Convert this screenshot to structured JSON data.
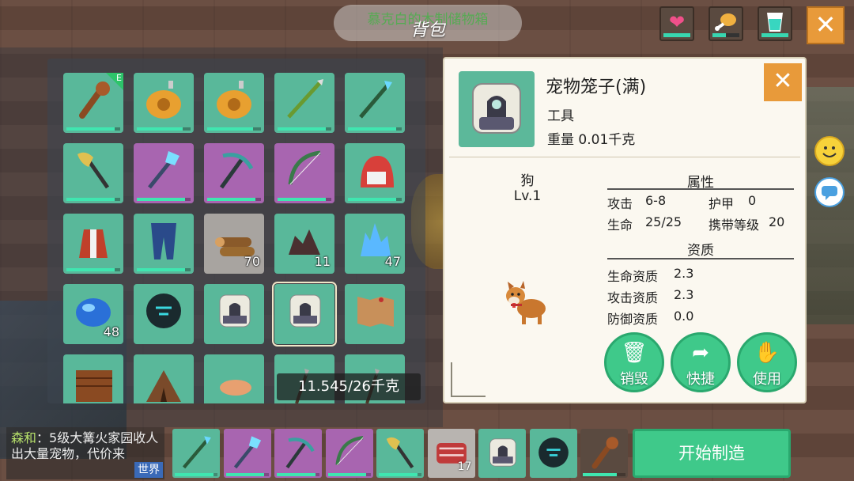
{
  "header": {
    "chest_title": "慕克白的木制储物箱",
    "title": "背包"
  },
  "stats": [
    {
      "name": "health",
      "icon": "heart-icon",
      "glyph": "❤",
      "color": "#f0508a",
      "level": 1.0
    },
    {
      "name": "hunger",
      "icon": "drumstick-icon",
      "glyph": "🍗",
      "color": "#f0b040",
      "level": 0.5
    },
    {
      "name": "thirst",
      "icon": "water-glass-icon",
      "glyph": "🥤",
      "color": "#38d6c0",
      "level": 1.0
    }
  ],
  "inventory": {
    "weight": "11.545/26千克",
    "items": [
      {
        "name": "wooden-club",
        "bg": "green",
        "dur": 0.9,
        "count": "",
        "equipped": true,
        "equip_label": "E"
      },
      {
        "name": "leather-water-bag",
        "bg": "green",
        "dur": 0.85,
        "count": ""
      },
      {
        "name": "leather-water-bag",
        "bg": "green",
        "dur": 0.85,
        "count": ""
      },
      {
        "name": "bamboo-spear",
        "bg": "green",
        "dur": 0.9,
        "count": ""
      },
      {
        "name": "crystal-spear",
        "bg": "green",
        "dur": 0.9,
        "count": ""
      },
      {
        "name": "battle-axe",
        "bg": "green",
        "dur": 0.9,
        "count": ""
      },
      {
        "name": "crystal-staff",
        "bg": "purple",
        "dur": 0.9,
        "count": ""
      },
      {
        "name": "pickaxe",
        "bg": "purple",
        "dur": 0.9,
        "count": ""
      },
      {
        "name": "bow",
        "bg": "purple",
        "dur": 0.9,
        "count": ""
      },
      {
        "name": "red-hood",
        "bg": "green",
        "dur": 0.9,
        "count": ""
      },
      {
        "name": "fur-coat",
        "bg": "green",
        "dur": 0.9,
        "count": ""
      },
      {
        "name": "pants",
        "bg": "green",
        "dur": 0.9,
        "count": ""
      },
      {
        "name": "wood-logs",
        "bg": "grey",
        "dur": 0,
        "count": "70"
      },
      {
        "name": "dark-ore",
        "bg": "green",
        "dur": 0,
        "count": "11"
      },
      {
        "name": "blue-crystals",
        "bg": "green",
        "dur": 0,
        "count": "47"
      },
      {
        "name": "blue-gem",
        "bg": "green",
        "dur": 0,
        "count": "48"
      },
      {
        "name": "dark-orb",
        "bg": "green",
        "dur": 0,
        "count": ""
      },
      {
        "name": "pet-cage",
        "bg": "green",
        "dur": 0,
        "count": ""
      },
      {
        "name": "pet-cage-selected",
        "bg": "green",
        "dur": 0,
        "count": "",
        "selected": true
      },
      {
        "name": "treasure-map",
        "bg": "green",
        "dur": 0,
        "count": ""
      },
      {
        "name": "wooden-crate",
        "bg": "green",
        "dur": 0,
        "count": ""
      },
      {
        "name": "tent",
        "bg": "green",
        "dur": 0,
        "count": ""
      },
      {
        "name": "fish-item",
        "bg": "green",
        "dur": 0,
        "count": ""
      },
      {
        "name": "spear-item",
        "bg": "green",
        "dur": 0,
        "count": ""
      },
      {
        "name": "spear-item-2",
        "bg": "green",
        "dur": 0,
        "count": ""
      }
    ]
  },
  "detail": {
    "name": "宠物笼子(满)",
    "type": "工具",
    "weight": "重量 0.01千克",
    "pet_name": "狗",
    "pet_level": "Lv.1",
    "attr_header": "属性",
    "attack_label": "攻击",
    "attack_value": "6-8",
    "armor_label": "护甲",
    "armor_value": "0",
    "hp_label": "生命",
    "hp_value": "25/25",
    "carry_label": "携带等级",
    "carry_value": "20",
    "aptitude_header": "资质",
    "hp_apt_label": "生命资质",
    "hp_apt_value": "2.3",
    "atk_apt_label": "攻击资质",
    "atk_apt_value": "2.3",
    "def_apt_label": "防御资质",
    "def_apt_value": "0.0",
    "buttons": {
      "destroy": "销毁",
      "shortcut": "快捷",
      "use": "使用"
    }
  },
  "chat": {
    "sender": "森和",
    "message": "：5级大篝火家园收人　出大量宠物，代价来",
    "channel": "世界"
  },
  "hotbar": {
    "items": [
      {
        "name": "crystal-spear",
        "bg": "green",
        "dur": 0.9,
        "count": ""
      },
      {
        "name": "crystal-staff",
        "bg": "purple",
        "dur": 0.9,
        "count": ""
      },
      {
        "name": "pickaxe",
        "bg": "purple",
        "dur": 0.9,
        "count": ""
      },
      {
        "name": "bow",
        "bg": "purple",
        "dur": 0.9,
        "count": ""
      },
      {
        "name": "battle-axe",
        "bg": "green",
        "dur": 0.9,
        "count": ""
      },
      {
        "name": "raw-meat",
        "bg": "grey",
        "dur": 0,
        "count": "17"
      },
      {
        "name": "pet-cage",
        "bg": "green",
        "dur": 0,
        "count": ""
      },
      {
        "name": "dark-orb",
        "bg": "green",
        "dur": 0,
        "count": ""
      },
      {
        "name": "wooden-club",
        "bg": "dark",
        "dur": 0.8,
        "count": ""
      }
    ],
    "craft_label": "开始制造"
  }
}
